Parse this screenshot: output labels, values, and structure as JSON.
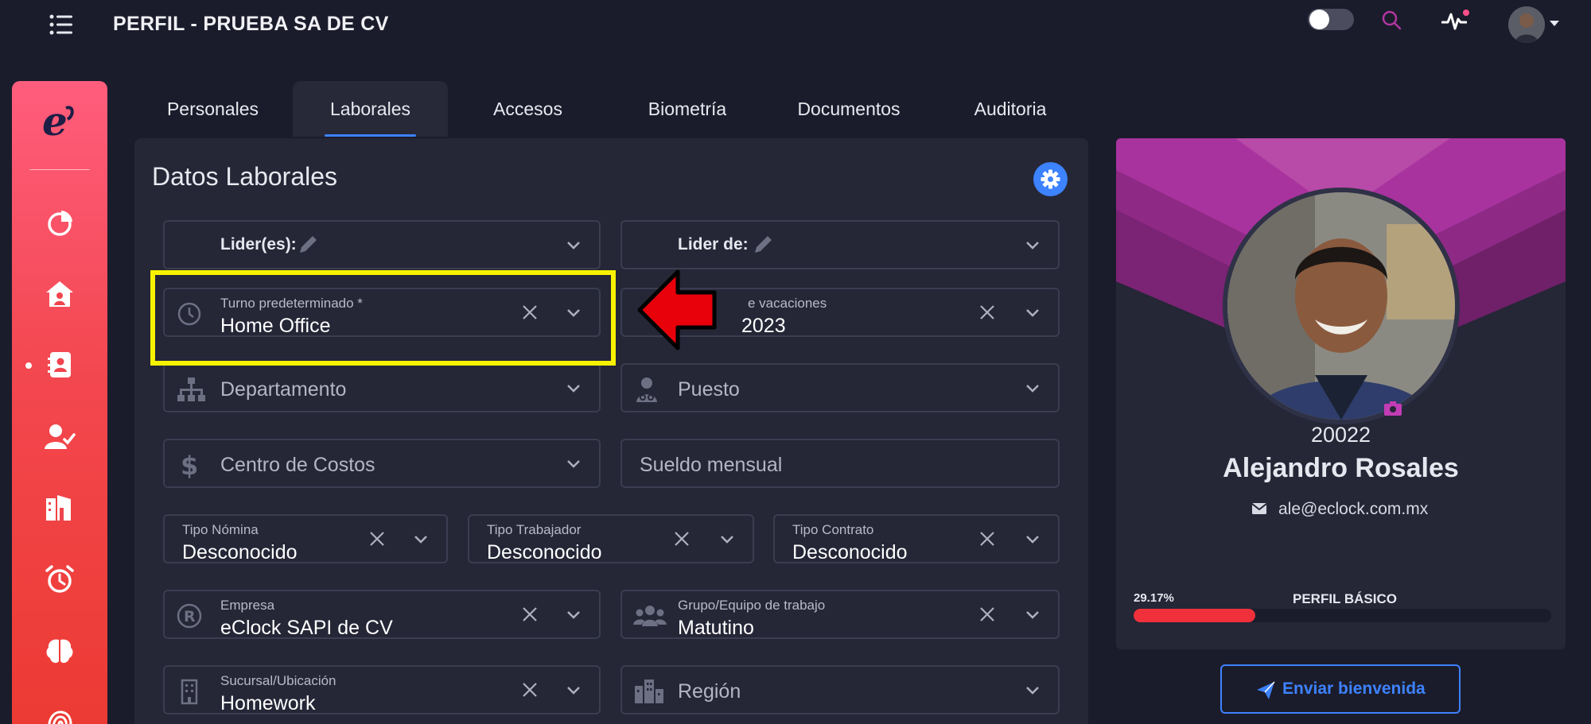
{
  "header": {
    "title": "PERFIL - PRUEBA SA DE CV"
  },
  "tabs": [
    {
      "label": "Personales",
      "active": false
    },
    {
      "label": "Laborales",
      "active": true
    },
    {
      "label": "Accesos",
      "active": false
    },
    {
      "label": "Biometría",
      "active": false
    },
    {
      "label": "Documentos",
      "active": false
    },
    {
      "label": "Auditoria",
      "active": false
    }
  ],
  "section": {
    "title": "Datos Laborales"
  },
  "fields": {
    "lideres": {
      "label": "Lider(es):"
    },
    "lider_de": {
      "label": "Lider de:"
    },
    "turno": {
      "label": "Turno predeterminado *",
      "value": "Home Office"
    },
    "vacaciones": {
      "label": "e vacaciones",
      "value": "2023"
    },
    "departamento": {
      "placeholder": "Departamento"
    },
    "puesto": {
      "placeholder": "Puesto"
    },
    "centro_costos": {
      "placeholder": "Centro de Costos"
    },
    "sueldo": {
      "placeholder": "Sueldo mensual"
    },
    "tipo_nomina": {
      "label": "Tipo Nómina",
      "value": "Desconocido"
    },
    "tipo_trabajador": {
      "label": "Tipo Trabajador",
      "value": "Desconocido"
    },
    "tipo_contrato": {
      "label": "Tipo Contrato",
      "value": "Desconocido"
    },
    "empresa": {
      "label": "Empresa",
      "value": "eClock SAPI de CV"
    },
    "grupo": {
      "label": "Grupo/Equipo de trabajo",
      "value": "Matutino"
    },
    "sucursal": {
      "label": "Sucursal/Ubicación",
      "value": "Homework"
    },
    "region": {
      "placeholder": "Región"
    }
  },
  "profile": {
    "employee_number": "20022",
    "name": "Alejandro Rosales",
    "email": "ale@eclock.com.mx",
    "progress_text": "29.17%",
    "progress_value": 0.2917,
    "progress_label": "PERFIL BÁSICO",
    "welcome_button": "Enviar bienvenida"
  },
  "colors": {
    "accent": "#3d82ff",
    "sidebar_top": "#ff5d7d",
    "sidebar_bottom": "#ec3a32",
    "banner": "#a8339e",
    "highlight": "#f8f200",
    "arrow": "#e8000b",
    "progress": "#f0313c"
  }
}
